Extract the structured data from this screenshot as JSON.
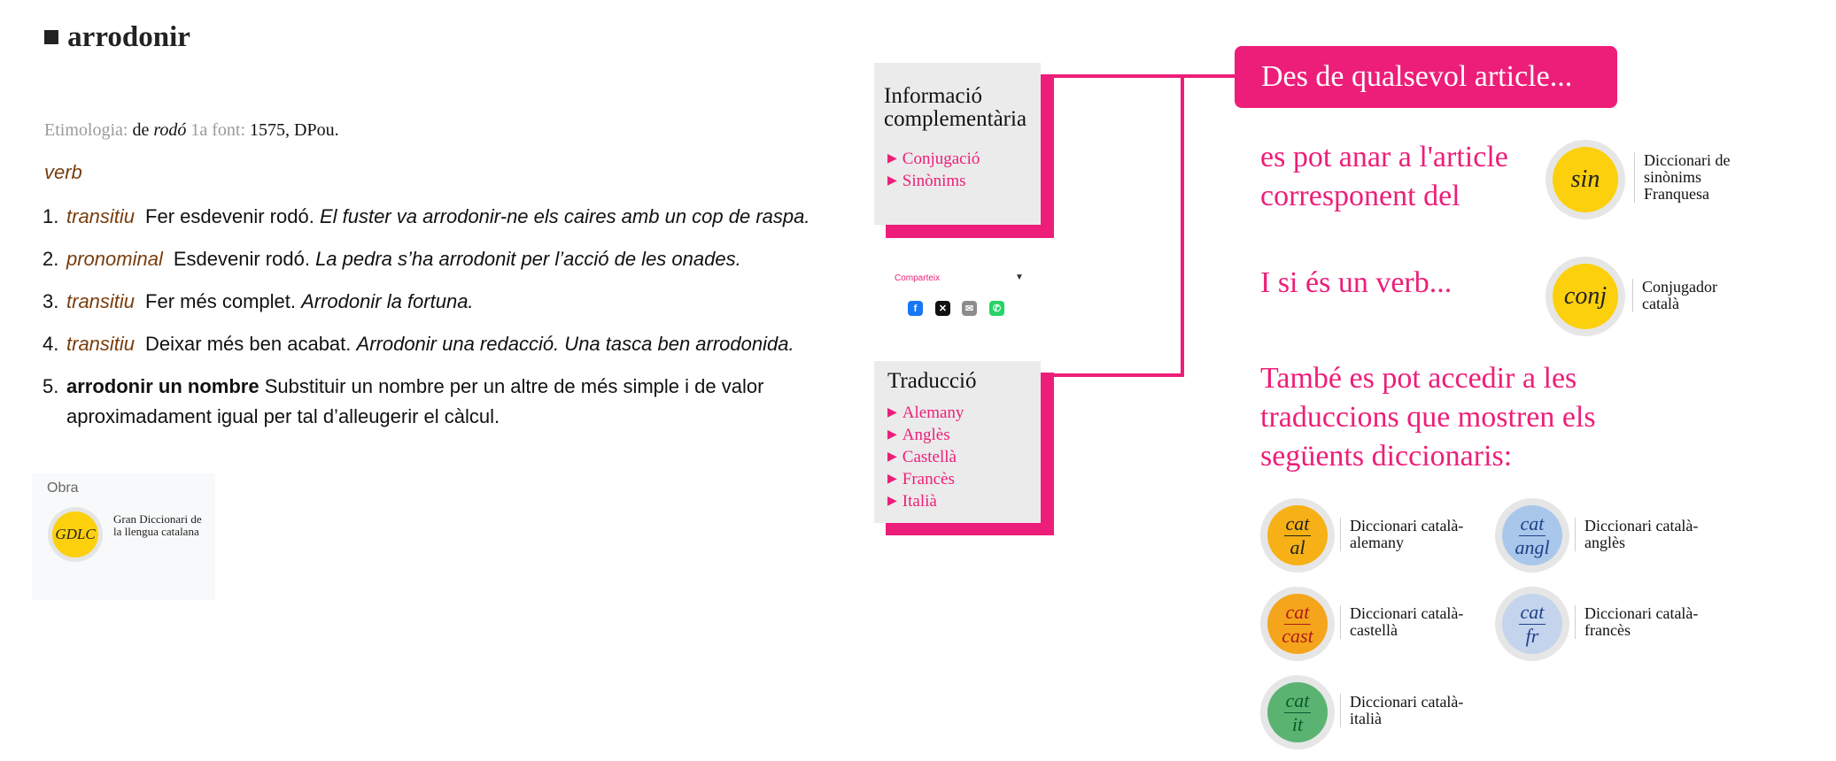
{
  "article": {
    "headword": "■ arrodonir",
    "etymology": {
      "label": "Etimologia:",
      "prefix": "de",
      "source": "rodó",
      "first_source_label": "1a font:",
      "first_source_value": "1575, DPou."
    },
    "part_of_speech": "verb",
    "senses": [
      {
        "num": "1.",
        "gram": "transitiu",
        "definition": "Fer esdevenir rodó.",
        "example": "El fuster va arrodonir-ne els caires amb un cop de raspa."
      },
      {
        "num": "2.",
        "gram": "pronominal",
        "definition": "Esdevenir rodó.",
        "example": "La pedra s’ha arrodonit per l’acció de les onades."
      },
      {
        "num": "3.",
        "gram": "transitiu",
        "definition": "Fer més complet.",
        "example": "Arrodonir la fortuna."
      },
      {
        "num": "4.",
        "gram": "transitiu",
        "definition": "Deixar més ben acabat.",
        "example": "Arrodonir una redacció. Una tasca ben arrodonida."
      },
      {
        "num": "5.",
        "phrase": "arrodonir un nombre",
        "definition": "Substituir un nombre per un altre de més simple i de valor aproximadament igual per tal d’alleugerir el càlcul."
      }
    ],
    "obra": {
      "label": "Obra",
      "badge": "GDLC",
      "name": "Gran Diccionari de la llengua catalana"
    }
  },
  "info_panel": {
    "title": "Informació complementària",
    "links": [
      "Conjugació",
      "Sinònims"
    ]
  },
  "share": {
    "label": "Comparteix",
    "icons": [
      "facebook-icon",
      "x-icon",
      "email-icon",
      "whatsapp-icon"
    ]
  },
  "translation_panel": {
    "title": "Traducció",
    "links": [
      "Alemany",
      "Anglès",
      "Castellà",
      "Francès",
      "Italià"
    ]
  },
  "callouts": {
    "header": "Des de qualsevol article...",
    "synonyms_text": "es pot anar a l'article corresponent del",
    "synonyms_badge": "sin",
    "synonyms_dict": "Diccionari de sinònims Franquesa",
    "verb_text": "I si és un verb...",
    "conj_badge": "conj",
    "conj_dict": "Conjugador català",
    "translations_text": "També es pot accedir a les traduccions que mostren els següents diccionaris:",
    "dictionaries": [
      {
        "top": "cat",
        "bottom": "al",
        "name": "Diccionari català-alemany",
        "color": "#f7b116"
      },
      {
        "top": "cat",
        "bottom": "angl",
        "name": "Diccionari català-anglès",
        "color": "#a9c7ea"
      },
      {
        "top": "cat",
        "bottom": "cast",
        "name": "Diccionari català-castellà",
        "color": "#f4a51c"
      },
      {
        "top": "cat",
        "bottom": "fr",
        "name": "Diccionari català-francès",
        "color": "#c3d4ec"
      },
      {
        "top": "cat",
        "bottom": "it",
        "name": "Diccionari català-italià",
        "color": "#5bb371"
      }
    ]
  },
  "colors": {
    "accent": "#ed1e79",
    "gram_brown": "#7a3d0c",
    "badge_yellow": "#fcd00c"
  }
}
